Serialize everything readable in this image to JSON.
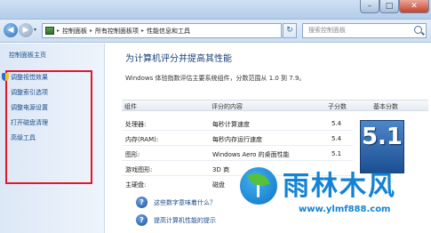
{
  "window": {
    "minimize_glyph": "–",
    "maximize_glyph": "□",
    "close_glyph": "✕"
  },
  "address_bar": {
    "back_glyph": "◀",
    "forward_glyph": "▶",
    "dropdown_glyph": "▾",
    "breadcrumbs": [
      "控制面板",
      "所有控制面板项",
      "性能信息和工具"
    ],
    "separator": "▸",
    "refresh_glyph": "↻",
    "search_placeholder": "搜索控制面板"
  },
  "sidebar": {
    "home_label": "控制面板主页",
    "items": [
      "调整视觉效果",
      "调整索引选项",
      "调整电源设置",
      "打开磁盘清理",
      "高级工具"
    ]
  },
  "main": {
    "heading": "为计算机评分并提高其性能",
    "description": "Windows 体验指数评估主要系统组件，分数范围从 1.0 到 7.9。",
    "columns": {
      "component": "组件",
      "rated": "评分的内容",
      "subscore": "子分数",
      "basescore": "基本分数"
    },
    "rows": [
      {
        "component": "处理器:",
        "rated": "每秒计算速度",
        "subscore": "5.4"
      },
      {
        "component": "内存(RAM):",
        "rated": "每秒内存运行速度",
        "subscore": "5.4"
      },
      {
        "component": "图形:",
        "rated": "Windows Aero 的桌面性能",
        "subscore": "5.1"
      },
      {
        "component": "游戏图形:",
        "rated": "3D 商",
        "subscore": ""
      },
      {
        "component": "主硬盘:",
        "rated": "磁盘",
        "subscore": ""
      }
    ],
    "base_score": "5.1",
    "help_links": [
      "这些数字意味着什么？",
      "提高计算机性能的提示"
    ]
  },
  "watermark": {
    "title": "雨林木风",
    "url": "www.ylmf888.com"
  }
}
